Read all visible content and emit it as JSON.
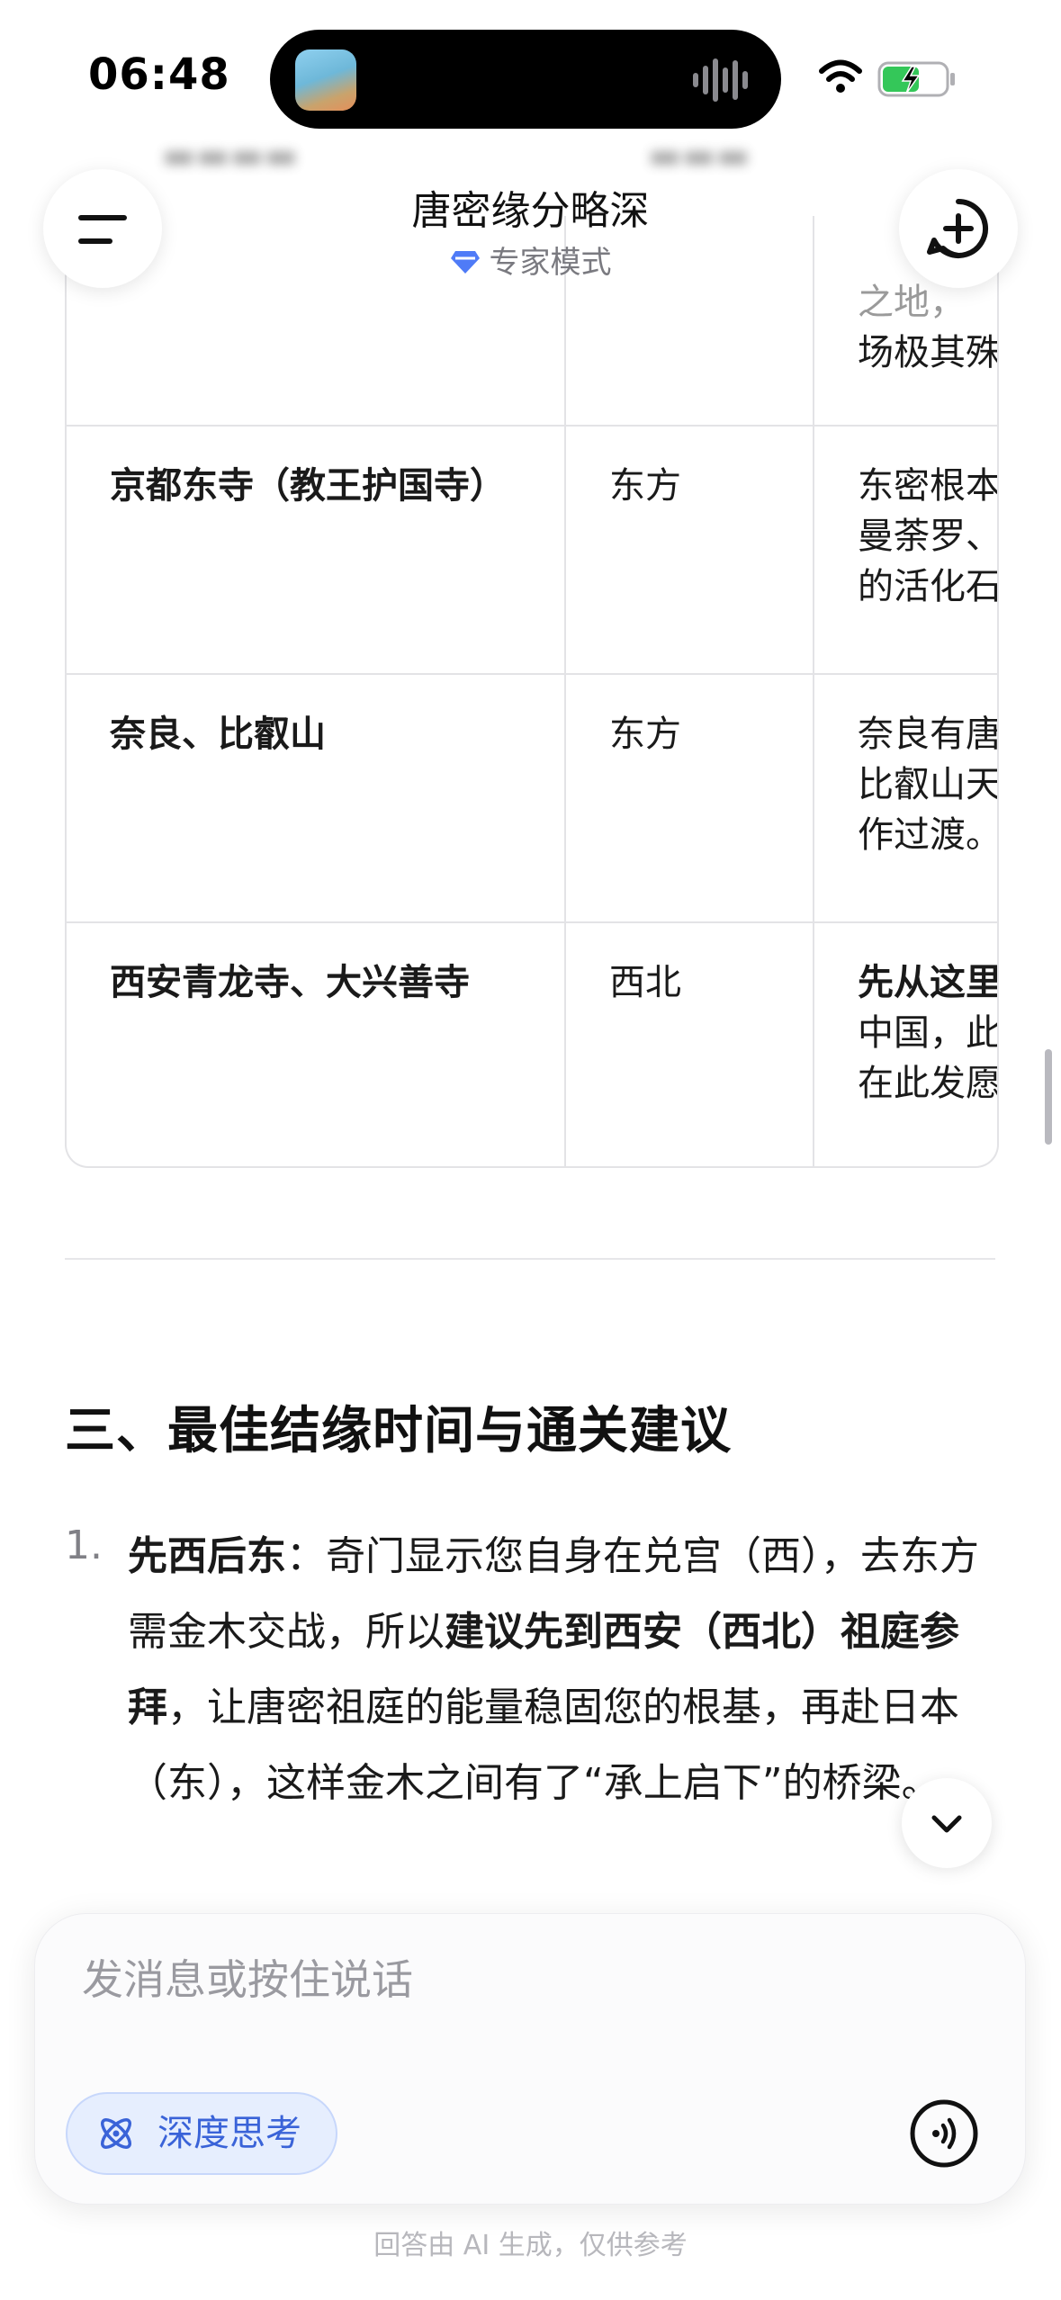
{
  "status_bar": {
    "time": "06:48"
  },
  "header": {
    "title": "唐密缘分略深",
    "mode_label": "专家模式"
  },
  "table": {
    "partial_top_row": {
      "cell3_visible_lines": [
        "之地，",
        "场极其殊"
      ]
    },
    "rows": [
      {
        "place": "京都东寺（教王护国寺）",
        "direction": "东方",
        "note_lines": [
          "东密根本",
          "曼荼罗、",
          "的活化石"
        ]
      },
      {
        "place": "奈良、比叡山",
        "direction": "东方",
        "note_lines": [
          "奈良有唐",
          "比叡山天",
          "作过渡。"
        ]
      },
      {
        "place": "西安青龙寺、大兴善寺",
        "direction": "西北",
        "note_lines": [
          "先从这里",
          "中国，此",
          "在此发愿"
        ]
      }
    ]
  },
  "section": {
    "heading": "三、最佳结缘时间与通关建议",
    "item_number": "1.",
    "item_lead": "先西后东",
    "item_text_1": "：奇门显示您自身在兑宫（西），去东方需金木交战，所以",
    "item_bold_2": "建议先到西安（西北）祖庭参拜",
    "item_text_3": "，让唐密祖庭的能量稳固您的根基，再赴日本（东），这样金木之间有了“承上启下”的桥梁。"
  },
  "composer": {
    "placeholder": "发消息或按住说话",
    "deep_think_label": "深度思考"
  },
  "footer": {
    "disclaimer": "回答由 AI 生成，仅供参考"
  },
  "icons": {
    "menu": "menu-icon",
    "new_chat": "new-chat-icon",
    "mode": "diamond-icon",
    "scroll_down": "chevron-down-icon",
    "deep_think": "atom-icon",
    "voice": "voice-icon"
  },
  "colors": {
    "accent_blue": "#3a63d8",
    "deep_think_bg": "#e6eefe",
    "mode_icon": "#4f7bf7"
  }
}
